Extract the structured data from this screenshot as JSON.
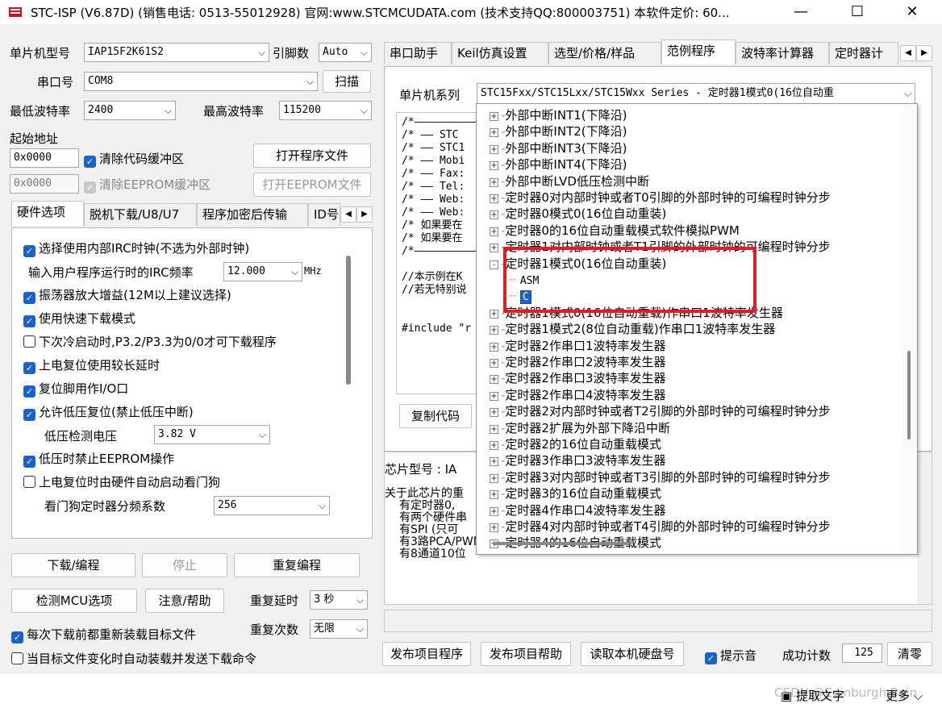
{
  "window": {
    "title": "STC-ISP (V6.87D) (销售电话: 0513-55012928) 官网:www.STCMCUDATA.com  (技术支持QQ:800003751) 本软件定价: 60...",
    "minimize": "—",
    "maximize": "☐",
    "close": "✕"
  },
  "left": {
    "mcu_model_label": "单片机型号",
    "mcu_model_value": "IAP15F2K61S2",
    "pin_label": "引脚数",
    "pin_value": "Auto",
    "port_label": "串口号",
    "port_value": "COM8",
    "scan_button": "扫描",
    "min_baud_label": "最低波特率",
    "min_baud_value": "2400",
    "max_baud_label": "最高波特率",
    "max_baud_value": "115200",
    "start_addr_label": "起始地址",
    "addr1": "0x0000",
    "clear_code": "清除代码缓冲区",
    "open_prog": "打开程序文件",
    "addr2": "0x0000",
    "clear_eeprom": "清除EEPROM缓冲区",
    "open_eeprom": "打开EEPROM文件",
    "tabs": [
      "硬件选项",
      "脱机下载/U8/U7",
      "程序加密后传输",
      "ID号"
    ],
    "opt_irc": "选择使用内部IRC时钟(不选为外部时钟)",
    "irc_freq_label": "输入用户程序运行时的IRC频率",
    "irc_freq_value": "12.000",
    "irc_unit": "MHz",
    "opt_osc": "振荡器放大增益(12M以上建议选择)",
    "opt_fast": "使用快速下载模式",
    "opt_p32": "下次冷启动时,P3.2/P3.3为0/0才可下载程序",
    "opt_delay": "上电复位使用较长延时",
    "opt_reset": "复位脚用作I/O口",
    "opt_lvr": "允许低压复位(禁止低压中断)",
    "lv_label": "低压检测电压",
    "lv_value": "3.82 V",
    "opt_eeprom": "低压时禁止EEPROM操作",
    "opt_wdt": "上电复位时由硬件自动启动看门狗",
    "wdt_label": "看门狗定时器分频系数",
    "wdt_value": "256",
    "btn_download": "下载/编程",
    "btn_stop": "停止",
    "btn_reprog": "重复编程",
    "btn_check": "检测MCU选项",
    "btn_help": "注意/帮助",
    "repeat_delay_label": "重复延时",
    "repeat_delay_value": "3 秒",
    "repeat_count_label": "重复次数",
    "repeat_count_value": "无限",
    "opt_reload": "每次下载前都重新装载目标文件",
    "opt_auto": "当目标文件变化时自动装载并发送下载命令"
  },
  "right": {
    "tabs": [
      "串口助手",
      "Keil仿真设置",
      "选型/价格/样品",
      "范例程序",
      "波特率计算器",
      "定时器计"
    ],
    "series_label": "单片机系列",
    "series_value": "STC15Fxx/STC15Lxx/STC15Wxx Series - 定时器1模式0(16位自动重",
    "code_lines": [
      "/*——————————————",
      "/* —— STC",
      "/* —— STC1",
      "/* —— Mobi",
      "/* —— Fax:",
      "/* —— Tel:",
      "/* —— Web:",
      "/* —— Web:",
      "/* 如果要在",
      "/* 如果要在",
      "/*——————————————",
      "",
      "//本示例在K",
      "//若无特别说",
      "",
      "",
      "#include \"r",
      "",
      ""
    ],
    "copy_button": "复制代码",
    "chip_label": "芯片型号 : IA",
    "info_lines": [
      "关于此芯片的重",
      "有定时器0,",
      "有两个硬件串",
      "有SPI (只可",
      "有3路PCA/PWM",
      "有8通道10位"
    ],
    "bottom_buttons": [
      "发布项目程序",
      "发布项目帮助",
      "读取本机硬盘号"
    ],
    "sound_label": "提示音",
    "success_label": "成功计数",
    "success_value": "125",
    "clear_button": "清零"
  },
  "tree": {
    "items": [
      {
        "text": "外部中断INT1(下降沿)",
        "ex": "+"
      },
      {
        "text": "外部中断INT2(下降沿)",
        "ex": "+"
      },
      {
        "text": "外部中断INT3(下降沿)",
        "ex": "+"
      },
      {
        "text": "外部中断INT4(下降沿)",
        "ex": "+"
      },
      {
        "text": "外部中断LVD低压检测中断",
        "ex": "+"
      },
      {
        "text": "定时器0对内部时钟或者T0引脚的外部时钟的可编程时钟分步",
        "ex": "+"
      },
      {
        "text": "定时器0模式0(16位自动重装)",
        "ex": "+"
      },
      {
        "text": "定时器0的16位自动重载模式软件模拟PWM",
        "ex": "+"
      },
      {
        "text": "定时器1对内部时钟或者T1引脚的外部时钟的可编程时钟分步",
        "ex": "+"
      },
      {
        "text": "定时器1模式0(16位自动重装)",
        "ex": "-"
      },
      {
        "text": "ASM",
        "ex": ""
      },
      {
        "text": "C",
        "ex": ""
      },
      {
        "text": "定时器1模式0(16位自动重载)作串口1波特率发生器",
        "ex": "+"
      },
      {
        "text": "定时器1模式2(8位自动重载)作串口1波特率发生器",
        "ex": "+"
      },
      {
        "text": "定时器2作串口1波特率发生器",
        "ex": "+"
      },
      {
        "text": "定时器2作串口2波特率发生器",
        "ex": "+"
      },
      {
        "text": "定时器2作串口3波特率发生器",
        "ex": "+"
      },
      {
        "text": "定时器2作串口4波特率发生器",
        "ex": "+"
      },
      {
        "text": "定时器2对内部时钟或者T2引脚的外部时钟的可编程时钟分步",
        "ex": "+"
      },
      {
        "text": "定时器2扩展为外部下降沿中断",
        "ex": "+"
      },
      {
        "text": "定时器2的16位自动重载模式",
        "ex": "+"
      },
      {
        "text": "定时器3作串口3波特率发生器",
        "ex": "+"
      },
      {
        "text": "定时器3对内部时钟或者T3引脚的外部时钟的可编程时钟分步",
        "ex": "+"
      },
      {
        "text": "定时器3的16位自动重载模式",
        "ex": "+"
      },
      {
        "text": "定时器4作串口4波特率发生器",
        "ex": "+"
      },
      {
        "text": "定时器4对内部时钟或者T4引脚的外部时钟的可编程时钟分步",
        "ex": "+"
      },
      {
        "text": "定时器4的16位自动重载模式",
        "ex": "+"
      }
    ]
  },
  "footer": {
    "watermark": "CSDN @Edinburgh Bain",
    "extract_text": "提取文字",
    "more": "更多"
  },
  "colors": {
    "accent": "#1a62c9",
    "highlight": "#e31c23"
  }
}
